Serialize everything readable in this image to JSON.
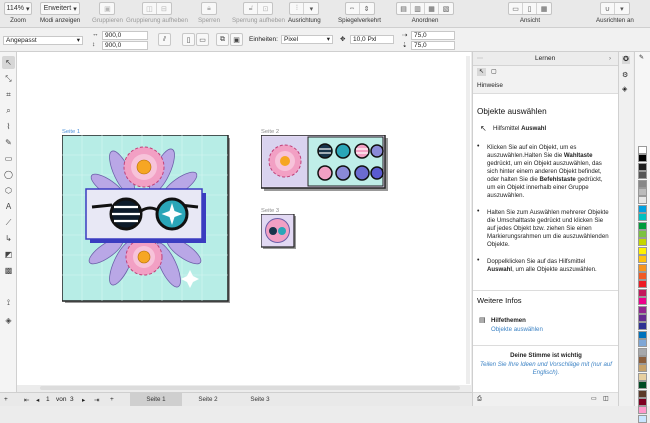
{
  "toolbar": {
    "zoom_value": "114%",
    "zoom_label": "Zoom",
    "mode_value": "Erweitert",
    "mode_label": "Modi anzeigen",
    "group_label": "Gruppieren",
    "ungroup_label": "Gruppierung aufheben",
    "lock_label": "Sperren",
    "unlock_label": "Sperrung aufheben",
    "align_label": "Ausrichtung",
    "mirror_label": "Spiegelverkehrt",
    "arrange_label": "Anordnen",
    "view_label": "Ansicht",
    "snap_label": "Ausrichten an"
  },
  "propbar": {
    "preset": "Angepasst",
    "width": "900,0",
    "height": "900,0",
    "units_label": "Einheiten:",
    "units_value": "Pixel",
    "nudge": "10,0 Pxl",
    "dup_x": "75,0",
    "dup_y": "75,0"
  },
  "pages": {
    "page1_label": "Seite 1",
    "page2_label": "Seite 2",
    "page3_label": "Seite 3"
  },
  "status": {
    "page_of": "1",
    "of_word": "von",
    "total": "3",
    "tabs": [
      "Seite 1",
      "Seite 2",
      "Seite 3"
    ]
  },
  "panel": {
    "title": "Lernen",
    "section": "Hinweise",
    "heading": "Objekte auswählen",
    "tool_prefix": "Hilfsmittel ",
    "tool_name": "Auswahl",
    "b1_l1": "Klicken Sie auf ein Objekt, um es",
    "b1_l2a": "auszuwählen.Halten Sie die ",
    "b1_l2b": "Wahltaste",
    "b1_l3": "gedrückt, um ein Objekt auszuwählen, das",
    "b1_l4": "sich hinter einem anderen Objekt befindet,",
    "b1_l5a": "oder halten Sie die ",
    "b1_l5b": "Befehlstaste",
    "b1_l5c": " gedrückt,",
    "b1_l6": "um ein Objekt innerhalb einer Gruppe",
    "b1_l7": "auszuwählen.",
    "b2_l1": "Halten Sie zum Auswählen mehrerer Objekte",
    "b2_l2": "die Umschalttaste gedrückt und klicken Sie",
    "b2_l3": "auf jedes Objekt bzw. ziehen Sie einen",
    "b2_l4": "Markierungsrahmen um die auszuwählenden",
    "b2_l5": "Objekte.",
    "b3_l1": "Doppelklicken Sie auf das Hilfsmittel",
    "b3_l2a": "Auswahl",
    "b3_l2b": ", um alle Objekte auszuwählen.",
    "more_heading": "Weitere Infos",
    "help_title": "Hilfethemen",
    "help_link": "Objekte auswählen",
    "vote_title": "Deine Stimme ist wichtig",
    "vote_l1": "Teilen Sie Ihre Ideen und Vorschläge mit (nur auf",
    "vote_l2": "Englisch)."
  },
  "colors": {
    "accent": "#3b82c4",
    "artwork_bg": "#b7ede6",
    "artwork_frame": "#3a3cc0",
    "petal_pink": "#f2a0c4"
  },
  "palette": [
    "#ffffff",
    "#000000",
    "#1e1e1e",
    "#555555",
    "#888888",
    "#bbbbbb",
    "#e6e6e6",
    "#00a0e0",
    "#00c0c0",
    "#009b3a",
    "#7dc242",
    "#c4d600",
    "#fff200",
    "#ffc20e",
    "#f7941d",
    "#f15a24",
    "#ed1c24",
    "#c2185b",
    "#ec008c",
    "#92278f",
    "#662d91",
    "#2e3192",
    "#0072bc",
    "#7fa7d6",
    "#a6a8ab",
    "#8b5e3c",
    "#c7a26b",
    "#e7cfa0",
    "#004b23",
    "#5b3a29",
    "#7d0022",
    "#ff99cc",
    "#c9e5ff"
  ]
}
